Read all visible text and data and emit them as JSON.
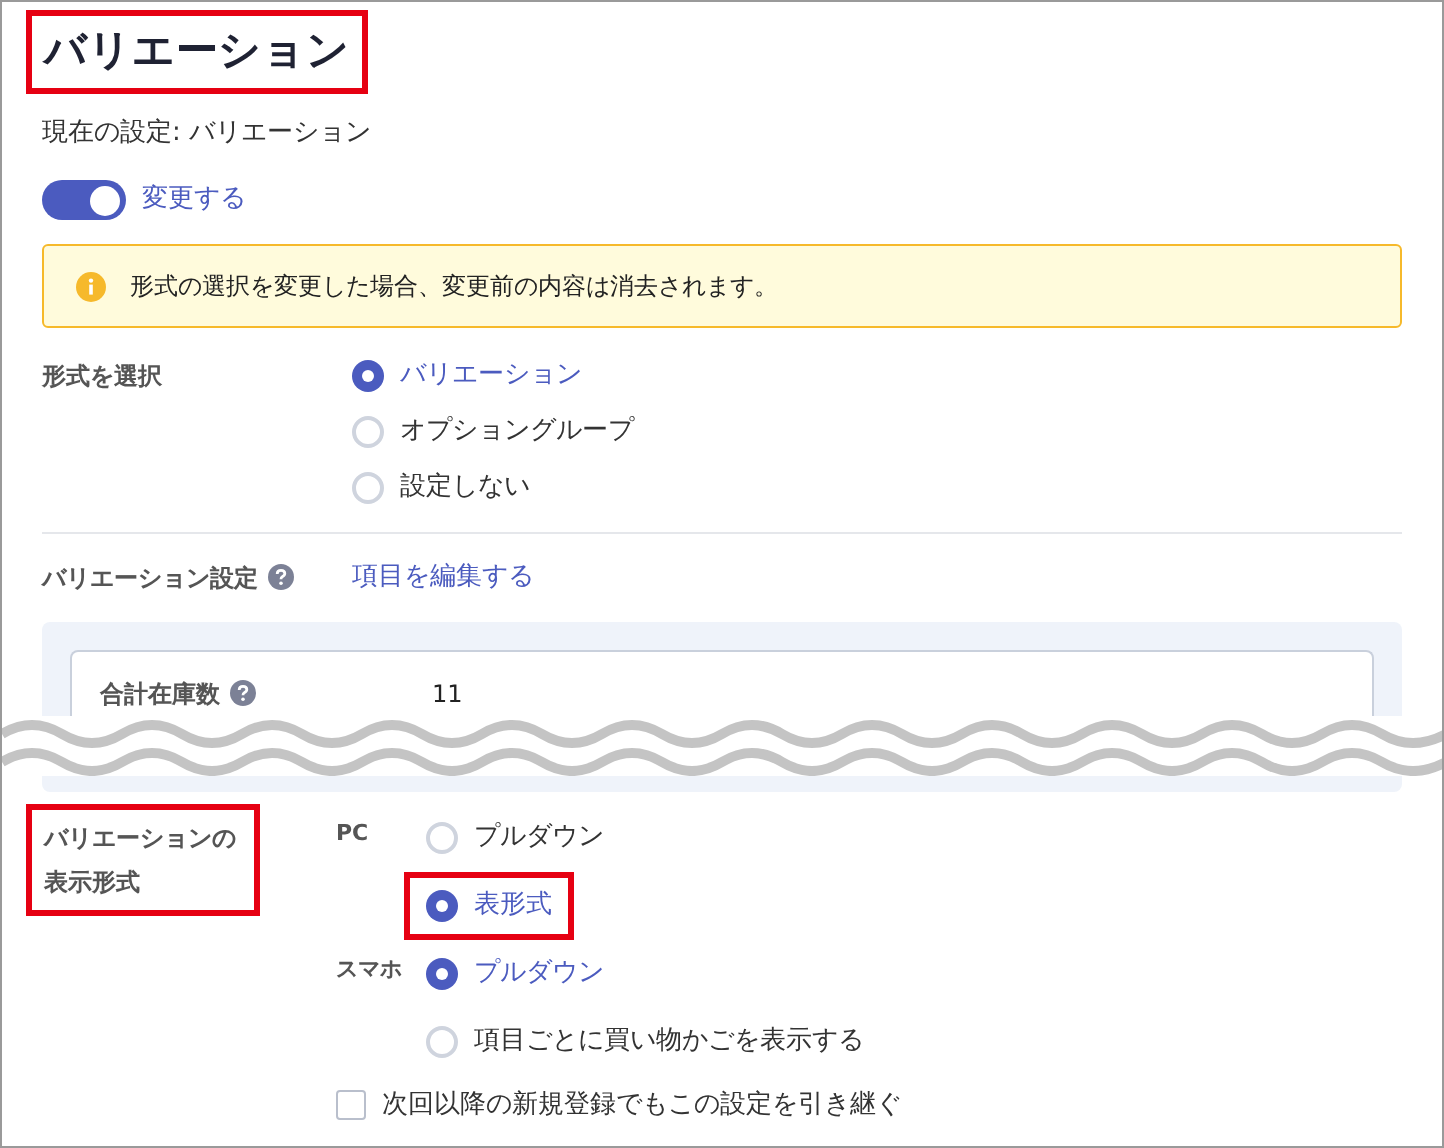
{
  "title": {
    "text": "バリエーション",
    "highlighted": true
  },
  "current_setting": "現在の設定: バリエーション",
  "change_toggle": {
    "label": "変更する",
    "on": true
  },
  "alert": "形式の選択を変更した場合、変更前の内容は消去されます。",
  "format": {
    "label": "形式を選択",
    "options": [
      {
        "label": "バリエーション",
        "selected": true
      },
      {
        "label": "オプショングループ",
        "selected": false
      },
      {
        "label": "設定しない",
        "selected": false
      }
    ]
  },
  "variation_settings": {
    "label": "バリエーション設定",
    "link": "項目を編集する",
    "stock": {
      "label": "合計在庫数",
      "value": "11"
    }
  },
  "display": {
    "label": "バリエーションの表示形式",
    "highlighted": true,
    "groups": [
      {
        "device": "PC",
        "options": [
          {
            "label": "プルダウン",
            "selected": false,
            "highlighted": false
          },
          {
            "label": "表形式",
            "selected": true,
            "highlighted": true
          }
        ]
      },
      {
        "device": "スマホ",
        "options": [
          {
            "label": "プルダウン",
            "selected": true,
            "highlighted": false
          },
          {
            "label": "項目ごとに買い物かごを表示する",
            "selected": false,
            "highlighted": false
          }
        ]
      }
    ],
    "carry_over": {
      "label": "次回以降の新規登録でもこの設定を引き継ぐ",
      "checked": false
    }
  }
}
